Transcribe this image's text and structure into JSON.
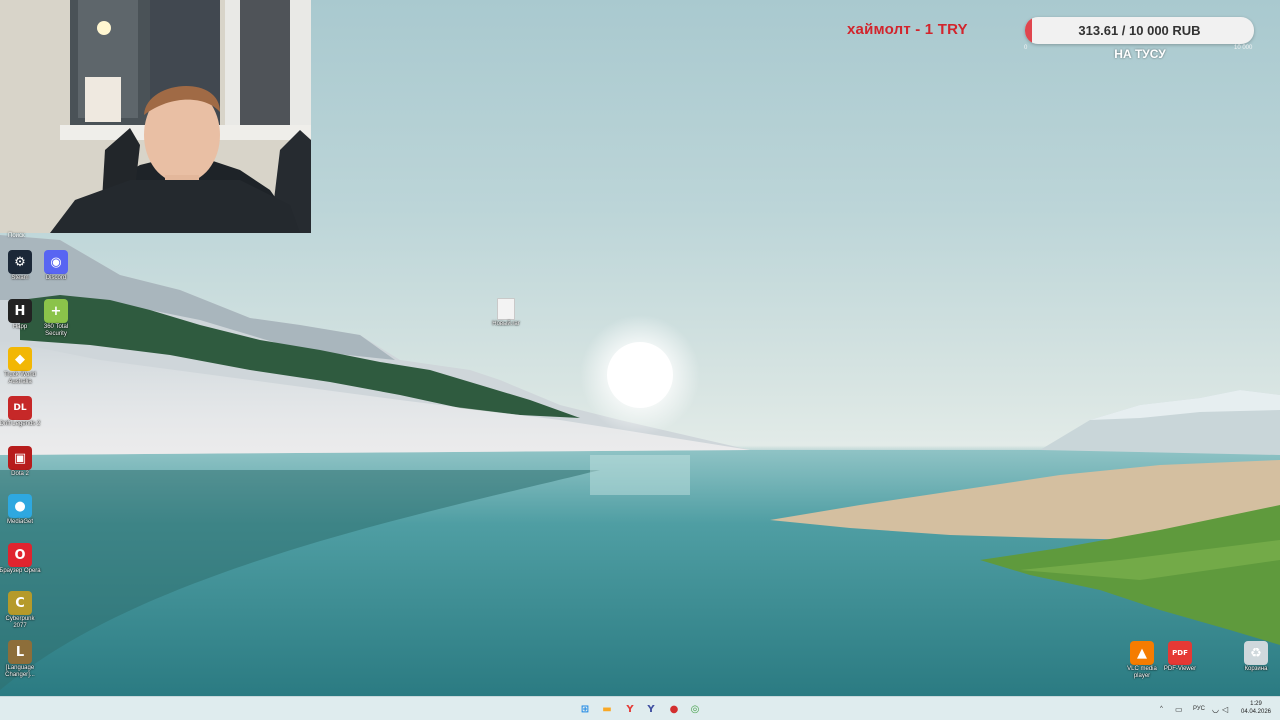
{
  "goal": {
    "title": "хаймолт - 1 TRY",
    "amount_text": "313.61 / 10 000 RUB",
    "progress_fraction": 0.031,
    "min_label": "0",
    "max_label": "10 000",
    "caption": "НА ТУСУ",
    "fill_color": "#e0464e",
    "title_color": "#d2242c"
  },
  "desktop": {
    "search_label": "Поиск",
    "left_icons": [
      {
        "label": "Steam",
        "icon": "steam-icon",
        "color": "#1b2838",
        "glyph": "⚙"
      },
      {
        "label": "Discord",
        "icon": "discord-icon",
        "color": "#5865f2",
        "glyph": "◉"
      },
      {
        "label": "Happ",
        "icon": "happ-icon",
        "color": "#222222",
        "glyph": "H"
      },
      {
        "label": "360 Total Security",
        "icon": "shield-plus-icon",
        "color": "#8bc34a",
        "glyph": "+"
      },
      {
        "label": "Truck World Australia",
        "icon": "truck-sign-icon",
        "color": "#f2b705",
        "glyph": "◆"
      },
      {
        "label": "Drift Legends 2",
        "icon": "drift-legends-icon",
        "color": "#c62828",
        "glyph": "DL"
      },
      {
        "label": "Dota 2",
        "icon": "dota-icon",
        "color": "#b71c1c",
        "glyph": "▣"
      },
      {
        "label": "MediaGet",
        "icon": "mediaget-icon",
        "color": "#2ea8e0",
        "glyph": "●"
      },
      {
        "label": "Браузер Opera",
        "icon": "opera-icon",
        "color": "#e0242f",
        "glyph": "O"
      },
      {
        "label": "Cyberpunk 2077",
        "icon": "cyberpunk-icon",
        "color": "#b59a2a",
        "glyph": "C"
      },
      {
        "label": "[Language Changer]...",
        "icon": "language-changer-icon",
        "color": "#8d6e3a",
        "glyph": "L"
      }
    ],
    "center_file": {
      "label": "Новый.rar",
      "icon": "file-icon"
    },
    "right_icons": [
      {
        "label": "VLC media player",
        "icon": "vlc-cone-icon",
        "color": "#f57c00",
        "glyph": "▲"
      },
      {
        "label": "PDF-Viewer",
        "icon": "pdf-icon",
        "color": "#e53935",
        "glyph": "PDF"
      },
      {
        "label": "Корзина",
        "icon": "recycle-bin-icon",
        "color": "#cfd8dc",
        "glyph": "♻"
      }
    ]
  },
  "taskbar": {
    "apps": [
      {
        "name": "start",
        "icon": "windows-start-icon",
        "glyph": "⊞",
        "color": "#1e88e5"
      },
      {
        "name": "explorer",
        "icon": "folder-icon",
        "glyph": "▬",
        "color": "#f9a825"
      },
      {
        "name": "yandex",
        "icon": "yandex-browser-icon",
        "glyph": "Y",
        "color": "#e53935"
      },
      {
        "name": "app-y",
        "icon": "y-app-icon",
        "glyph": "Y",
        "color": "#3f4fa0"
      },
      {
        "name": "app-red",
        "icon": "red-app-icon",
        "glyph": "●",
        "color": "#d32f2f"
      },
      {
        "name": "chrome",
        "icon": "chrome-icon",
        "glyph": "◎",
        "color": "#43a047"
      }
    ],
    "tray": {
      "chevron": "^",
      "lang": "РУС",
      "time": "1:29",
      "date": "04.04.2026"
    }
  }
}
